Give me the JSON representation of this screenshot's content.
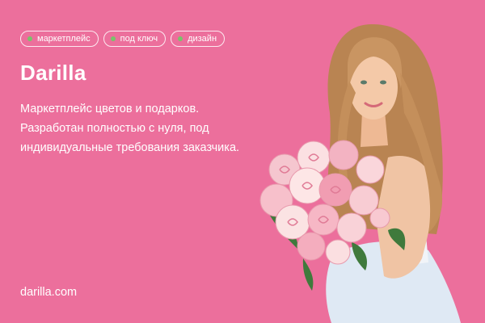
{
  "tags": [
    {
      "label": "маркетплейс"
    },
    {
      "label": "под ключ"
    },
    {
      "label": "дизайн"
    }
  ],
  "title": "Darilla",
  "description": {
    "lines": [
      "Маркетплейс цветов и подарков.",
      "Разработан полностью с нуля, под",
      "индивидуальные требования заказчика."
    ]
  },
  "domain": "darilla.com",
  "colors": {
    "background": "#ec6f9c",
    "tag_dot": "#78c36b",
    "text": "#ffffff"
  },
  "photo": {
    "subject": "woman-holding-pink-roses-bouquet"
  }
}
